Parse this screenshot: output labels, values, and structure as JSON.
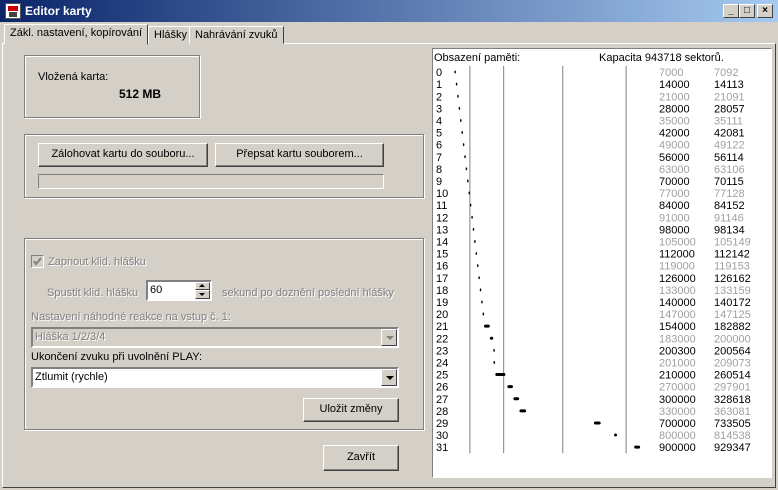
{
  "window": {
    "title": "Editor karty",
    "buttons": [
      "_",
      "□",
      "×"
    ]
  },
  "tabs": [
    {
      "label": "Zákl. nastavení, kopírování",
      "active": true
    },
    {
      "label": "Hlášky",
      "active": false
    },
    {
      "label": "Nahrávání zvuků",
      "active": false
    }
  ],
  "card": {
    "label": "Vložená karta:",
    "size": "512 MB"
  },
  "backup": {
    "backup_button": "Zálohovat kartu do souboru...",
    "restore_button": "Přepsat kartu souborem...",
    "progress": 0
  },
  "settings": {
    "enable_checkbox_label": "Zapnout klid. hlášku",
    "enable_checked": true,
    "start_label": "Spustit klid. hlášku",
    "start_value": "60",
    "start_suffix": "sekund po doznění poslední hlášky",
    "random_label": "Nastavení náhodné reakce na vstup č. 1:",
    "random_value": "Hláška 1/2/3/4",
    "end_label": "Ukončení zvuku při uvolnění PLAY:",
    "end_value": "Ztlumit (rychle)",
    "save_button": "Uložit změny"
  },
  "close_button": "Zavřít",
  "memory": {
    "header_left": "Obsazení paměti:",
    "header_right": "Kapacita 943718 sektorů.",
    "capacity": 943718,
    "rows": [
      {
        "idx": "0",
        "start": 7000,
        "end": 7092,
        "used": false
      },
      {
        "idx": "1",
        "start": 14000,
        "end": 14113,
        "used": true
      },
      {
        "idx": "2",
        "start": 21000,
        "end": 21091,
        "used": false
      },
      {
        "idx": "3",
        "start": 28000,
        "end": 28057,
        "used": true
      },
      {
        "idx": "4",
        "start": 35000,
        "end": 35111,
        "used": false
      },
      {
        "idx": "5",
        "start": 42000,
        "end": 42081,
        "used": true
      },
      {
        "idx": "6",
        "start": 49000,
        "end": 49122,
        "used": false
      },
      {
        "idx": "7",
        "start": 56000,
        "end": 56114,
        "used": true
      },
      {
        "idx": "8",
        "start": 63000,
        "end": 63106,
        "used": false
      },
      {
        "idx": "9",
        "start": 70000,
        "end": 70115,
        "used": true
      },
      {
        "idx": "10",
        "start": 77000,
        "end": 77128,
        "used": false
      },
      {
        "idx": "11",
        "start": 84000,
        "end": 84152,
        "used": true
      },
      {
        "idx": "12",
        "start": 91000,
        "end": 91146,
        "used": false
      },
      {
        "idx": "13",
        "start": 98000,
        "end": 98134,
        "used": true
      },
      {
        "idx": "14",
        "start": 105000,
        "end": 105149,
        "used": false
      },
      {
        "idx": "15",
        "start": 112000,
        "end": 112142,
        "used": true
      },
      {
        "idx": "16",
        "start": 119000,
        "end": 119153,
        "used": false
      },
      {
        "idx": "17",
        "start": 126000,
        "end": 126162,
        "used": true
      },
      {
        "idx": "18",
        "start": 133000,
        "end": 133159,
        "used": false
      },
      {
        "idx": "19",
        "start": 140000,
        "end": 140172,
        "used": true
      },
      {
        "idx": "20",
        "start": 147000,
        "end": 147125,
        "used": false
      },
      {
        "idx": "21",
        "start": 154000,
        "end": 182882,
        "used": true
      },
      {
        "idx": "22",
        "start": 183000,
        "end": 200000,
        "used": false
      },
      {
        "idx": "23",
        "start": 200300,
        "end": 200564,
        "used": true
      },
      {
        "idx": "24",
        "start": 201000,
        "end": 209073,
        "used": false
      },
      {
        "idx": "25",
        "start": 210000,
        "end": 260514,
        "used": true
      },
      {
        "idx": "26",
        "start": 270000,
        "end": 297901,
        "used": false
      },
      {
        "idx": "27",
        "start": 300000,
        "end": 328618,
        "used": true
      },
      {
        "idx": "28",
        "start": 330000,
        "end": 363081,
        "used": false
      },
      {
        "idx": "29",
        "start": 700000,
        "end": 733505,
        "used": true
      },
      {
        "idx": "30",
        "start": 800000,
        "end": 814538,
        "used": false
      },
      {
        "idx": "31",
        "start": 900000,
        "end": 929347,
        "used": true
      }
    ]
  },
  "colors": {
    "used_text": "#000000",
    "free_text": "#a0a0a0",
    "bar": "#000000",
    "gridline": "#808080"
  }
}
